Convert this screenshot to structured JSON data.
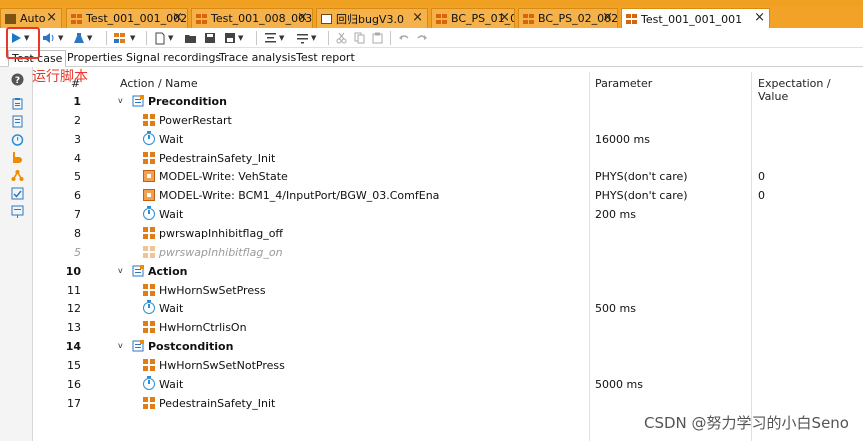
{
  "window": {
    "title_fragment": "Test 001"
  },
  "tabs": [
    {
      "label": "Auto",
      "active": false,
      "icon": "folder-icon"
    },
    {
      "label": "Test_001_001_002",
      "active": false,
      "icon": "grid-icon"
    },
    {
      "label": "Test_001_008_003",
      "active": false,
      "icon": "grid-icon"
    },
    {
      "label": "回归bugV3.0",
      "active": false,
      "icon": "doc-icon"
    },
    {
      "label": "BC_PS_01_001",
      "active": false,
      "icon": "grid-icon"
    },
    {
      "label": "BC_PS_02_002",
      "active": false,
      "icon": "grid-icon"
    },
    {
      "label": "Test_001_001_001",
      "active": true,
      "icon": "grid-icon"
    }
  ],
  "close_glyph": "×",
  "subtabs": [
    {
      "label": "Test case",
      "active": true
    },
    {
      "label": "Properties",
      "active": false
    },
    {
      "label": "Signal recordings",
      "active": false
    },
    {
      "label": "Trace analysis",
      "active": false
    },
    {
      "label": "Test report",
      "active": false
    }
  ],
  "annotation": {
    "label": "运行脚本",
    "color": "#e8372b"
  },
  "columns": {
    "num": "#",
    "action": "Action / Name",
    "parameter": "Parameter",
    "expectation": "Expectation / Value"
  },
  "rows": [
    {
      "num": "1",
      "level": 0,
      "expander": "v",
      "icon": "precondition-icon",
      "name": "Precondition",
      "param": "",
      "exp": "",
      "bold": true
    },
    {
      "num": "2",
      "level": 1,
      "icon": "function-icon",
      "name": "PowerRestart",
      "param": "",
      "exp": ""
    },
    {
      "num": "3",
      "level": 1,
      "icon": "wait-icon",
      "name": "Wait",
      "param": "16000 ms",
      "exp": ""
    },
    {
      "num": "4",
      "level": 1,
      "icon": "function-icon",
      "name": "PedestrainSafety_Init",
      "param": "",
      "exp": ""
    },
    {
      "num": "5",
      "level": 1,
      "icon": "model-write-icon",
      "name": "MODEL-Write: VehState",
      "param": "PHYS(don't care)",
      "exp": "0"
    },
    {
      "num": "6",
      "level": 1,
      "icon": "model-write-icon",
      "name": "MODEL-Write: BCM1_4/InputPort/BGW_03.ComfEna",
      "param": "PHYS(don't care)",
      "exp": "0"
    },
    {
      "num": "7",
      "level": 1,
      "icon": "wait-icon",
      "name": "Wait",
      "param": "200 ms",
      "exp": ""
    },
    {
      "num": "8",
      "level": 1,
      "icon": "function-icon",
      "name": "pwrswapInhibitflag_off",
      "param": "",
      "exp": ""
    },
    {
      "num": "5",
      "level": 1,
      "icon": "function-icon",
      "name": "pwrswapInhibitflag_on",
      "param": "",
      "exp": "",
      "disabled": true
    },
    {
      "num": "10",
      "level": 0,
      "expander": "v",
      "icon": "action-icon",
      "name": "Action",
      "param": "",
      "exp": "",
      "bold": true
    },
    {
      "num": "11",
      "level": 1,
      "icon": "function-icon",
      "name": "HwHornSwSetPress",
      "param": "",
      "exp": ""
    },
    {
      "num": "12",
      "level": 1,
      "icon": "wait-icon",
      "name": "Wait",
      "param": "500 ms",
      "exp": ""
    },
    {
      "num": "13",
      "level": 1,
      "icon": "function-icon",
      "name": "HwHornCtrlisOn",
      "param": "",
      "exp": ""
    },
    {
      "num": "14",
      "level": 0,
      "expander": "v",
      "icon": "postcondition-icon",
      "name": "Postcondition",
      "param": "",
      "exp": "",
      "bold": true
    },
    {
      "num": "15",
      "level": 1,
      "icon": "function-icon",
      "name": "HwHornSwSetNotPress",
      "param": "",
      "exp": ""
    },
    {
      "num": "16",
      "level": 1,
      "icon": "wait-icon",
      "name": "Wait",
      "param": "5000 ms",
      "exp": ""
    },
    {
      "num": "17",
      "level": 1,
      "icon": "function-icon",
      "name": "PedestrainSafety_Init",
      "param": "",
      "exp": ""
    }
  ],
  "watermark": "CSDN @努力学习的小白Seno",
  "colors": {
    "frame_orange": "#f2a227",
    "run_blue": "#1a79c8",
    "func_orange": "#e17c16",
    "wait_blue": "#2b8fd6"
  }
}
